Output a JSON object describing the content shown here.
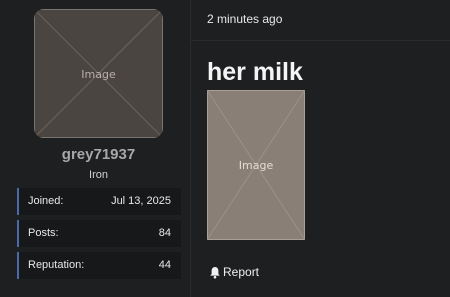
{
  "profile": {
    "avatar_label": "Image",
    "username": "grey71937",
    "rank": "Iron",
    "stats": [
      {
        "label": "Joined:",
        "value": "Jul 13, 2025"
      },
      {
        "label": "Posts:",
        "value": "84"
      },
      {
        "label": "Reputation:",
        "value": "44"
      }
    ]
  },
  "post": {
    "timestamp": "2 minutes ago",
    "title": "her milk",
    "image_label": "Image",
    "report_label": "Report"
  },
  "colors": {
    "background": "#1e1f21",
    "stat_background": "#17181a",
    "stat_accent": "#4b6aa8",
    "username": "#a8a8a8"
  },
  "icons": {
    "report": "bell-icon"
  }
}
